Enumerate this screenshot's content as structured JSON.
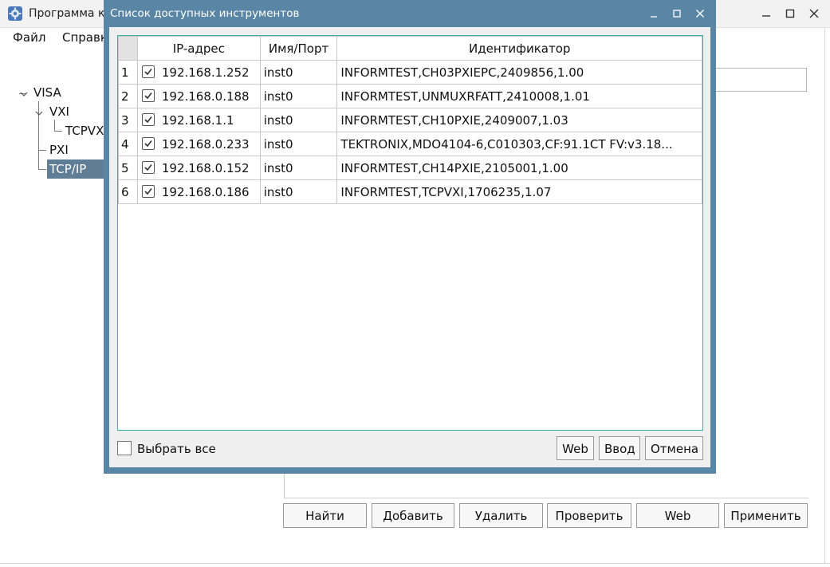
{
  "main_window": {
    "title": "Программа ко",
    "menu": [
      "Файл",
      "Справк"
    ],
    "tree": {
      "root": "VISA",
      "vxi": "VXI",
      "vxi_child": "TCPVX",
      "pxi": "PXI",
      "tcpip": "TCP/IP"
    },
    "buttons": {
      "find": "Найти",
      "add": "Добавить",
      "delete": "Удалить",
      "check": "Проверить",
      "web": "Web",
      "apply": "Применить"
    }
  },
  "dialog": {
    "title": "Список доступных инструментов",
    "columns": {
      "ip": "IP-адрес",
      "port": "Имя/Порт",
      "ident": "Идентификатор"
    },
    "rows": [
      {
        "num": "1",
        "ip": "192.168.1.252",
        "port": "inst0",
        "ident": "INFORMTEST,CH03PXIEPC,2409856,1.00",
        "checked": true
      },
      {
        "num": "2",
        "ip": "192.168.0.188",
        "port": "inst0",
        "ident": "INFORMTEST,UNMUXRFATT,2410008,1.01",
        "checked": true
      },
      {
        "num": "3",
        "ip": "192.168.1.1",
        "port": "inst0",
        "ident": "INFORMTEST,CH10PXIE,2409007,1.03",
        "checked": true
      },
      {
        "num": "4",
        "ip": "192.168.0.233",
        "port": "inst0",
        "ident": "TEKTRONIX,MDO4104-6,C010303,CF:91.1CT FV:v3.18...",
        "checked": true
      },
      {
        "num": "5",
        "ip": "192.168.0.152",
        "port": "inst0",
        "ident": "INFORMTEST,CH14PXIE,2105001,1.00",
        "checked": true
      },
      {
        "num": "6",
        "ip": "192.168.0.186",
        "port": "inst0",
        "ident": "INFORMTEST,TCPVXI,1706235,1.07",
        "checked": true
      }
    ],
    "select_all_label": "Выбрать все",
    "select_all_checked": false,
    "buttons": {
      "web": "Web",
      "enter": "Ввод",
      "cancel": "Отмена"
    }
  }
}
